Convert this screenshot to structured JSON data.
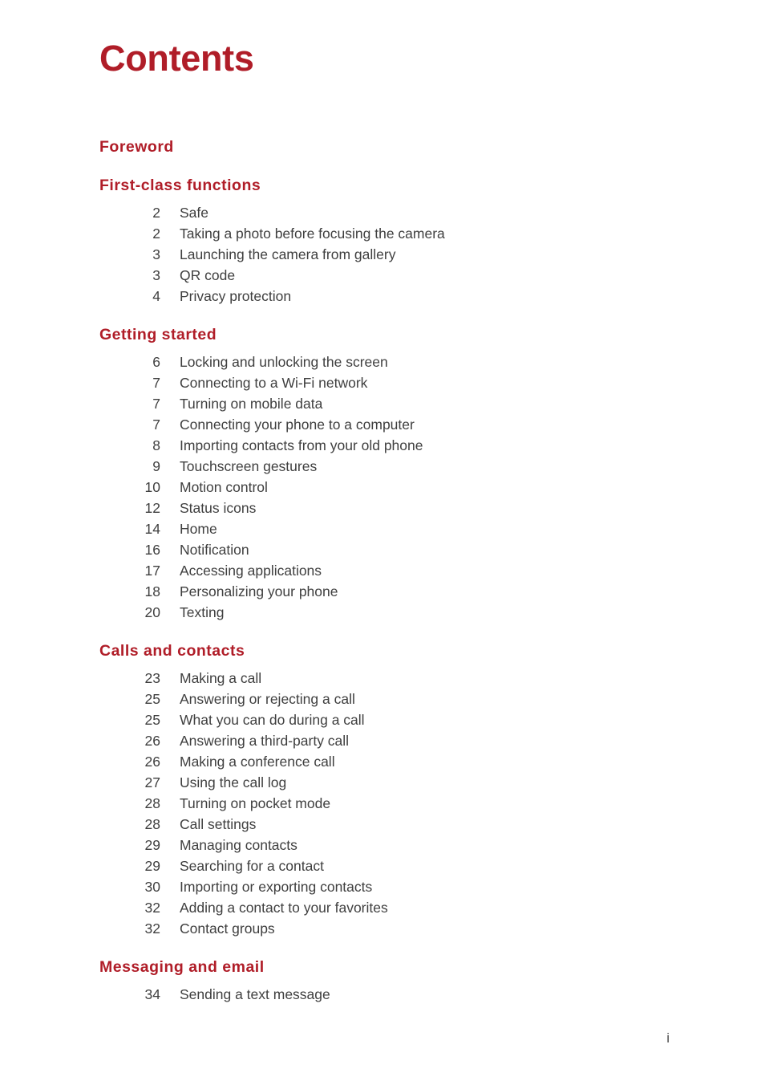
{
  "document": {
    "title": "Contents",
    "folio": "i",
    "accent_color": "#b01d28",
    "body_text_color": "#3f3f3f",
    "background_color": "#ffffff"
  },
  "sections": [
    {
      "heading": "Foreword",
      "entries": []
    },
    {
      "heading": "First-class functions",
      "entries": [
        {
          "page": "2",
          "label": "Safe"
        },
        {
          "page": "2",
          "label": "Taking a photo before focusing the camera"
        },
        {
          "page": "3",
          "label": "Launching the camera from gallery"
        },
        {
          "page": "3",
          "label": "QR code"
        },
        {
          "page": "4",
          "label": "Privacy protection"
        }
      ]
    },
    {
      "heading": "Getting started",
      "entries": [
        {
          "page": "6",
          "label": "Locking and unlocking the screen"
        },
        {
          "page": "7",
          "label": "Connecting to a Wi-Fi network"
        },
        {
          "page": "7",
          "label": "Turning on mobile data"
        },
        {
          "page": "7",
          "label": "Connecting your phone to a computer"
        },
        {
          "page": "8",
          "label": "Importing contacts from your old phone"
        },
        {
          "page": "9",
          "label": "Touchscreen gestures"
        },
        {
          "page": "10",
          "label": "Motion control"
        },
        {
          "page": "12",
          "label": "Status icons"
        },
        {
          "page": "14",
          "label": "Home"
        },
        {
          "page": "16",
          "label": "Notification"
        },
        {
          "page": "17",
          "label": "Accessing applications"
        },
        {
          "page": "18",
          "label": "Personalizing your phone"
        },
        {
          "page": "20",
          "label": "Texting"
        }
      ]
    },
    {
      "heading": "Calls and contacts",
      "entries": [
        {
          "page": "23",
          "label": "Making a call"
        },
        {
          "page": "25",
          "label": "Answering or rejecting a call"
        },
        {
          "page": "25",
          "label": "What you can do during a call"
        },
        {
          "page": "26",
          "label": "Answering a third-party call"
        },
        {
          "page": "26",
          "label": "Making a conference call"
        },
        {
          "page": "27",
          "label": "Using the call log"
        },
        {
          "page": "28",
          "label": "Turning on pocket mode"
        },
        {
          "page": "28",
          "label": "Call settings"
        },
        {
          "page": "29",
          "label": "Managing contacts"
        },
        {
          "page": "29",
          "label": "Searching for a contact"
        },
        {
          "page": "30",
          "label": "Importing or exporting contacts"
        },
        {
          "page": "32",
          "label": "Adding a contact to your favorites"
        },
        {
          "page": "32",
          "label": "Contact groups"
        }
      ]
    },
    {
      "heading": "Messaging and email",
      "entries": [
        {
          "page": "34",
          "label": "Sending a text message"
        }
      ]
    }
  ]
}
